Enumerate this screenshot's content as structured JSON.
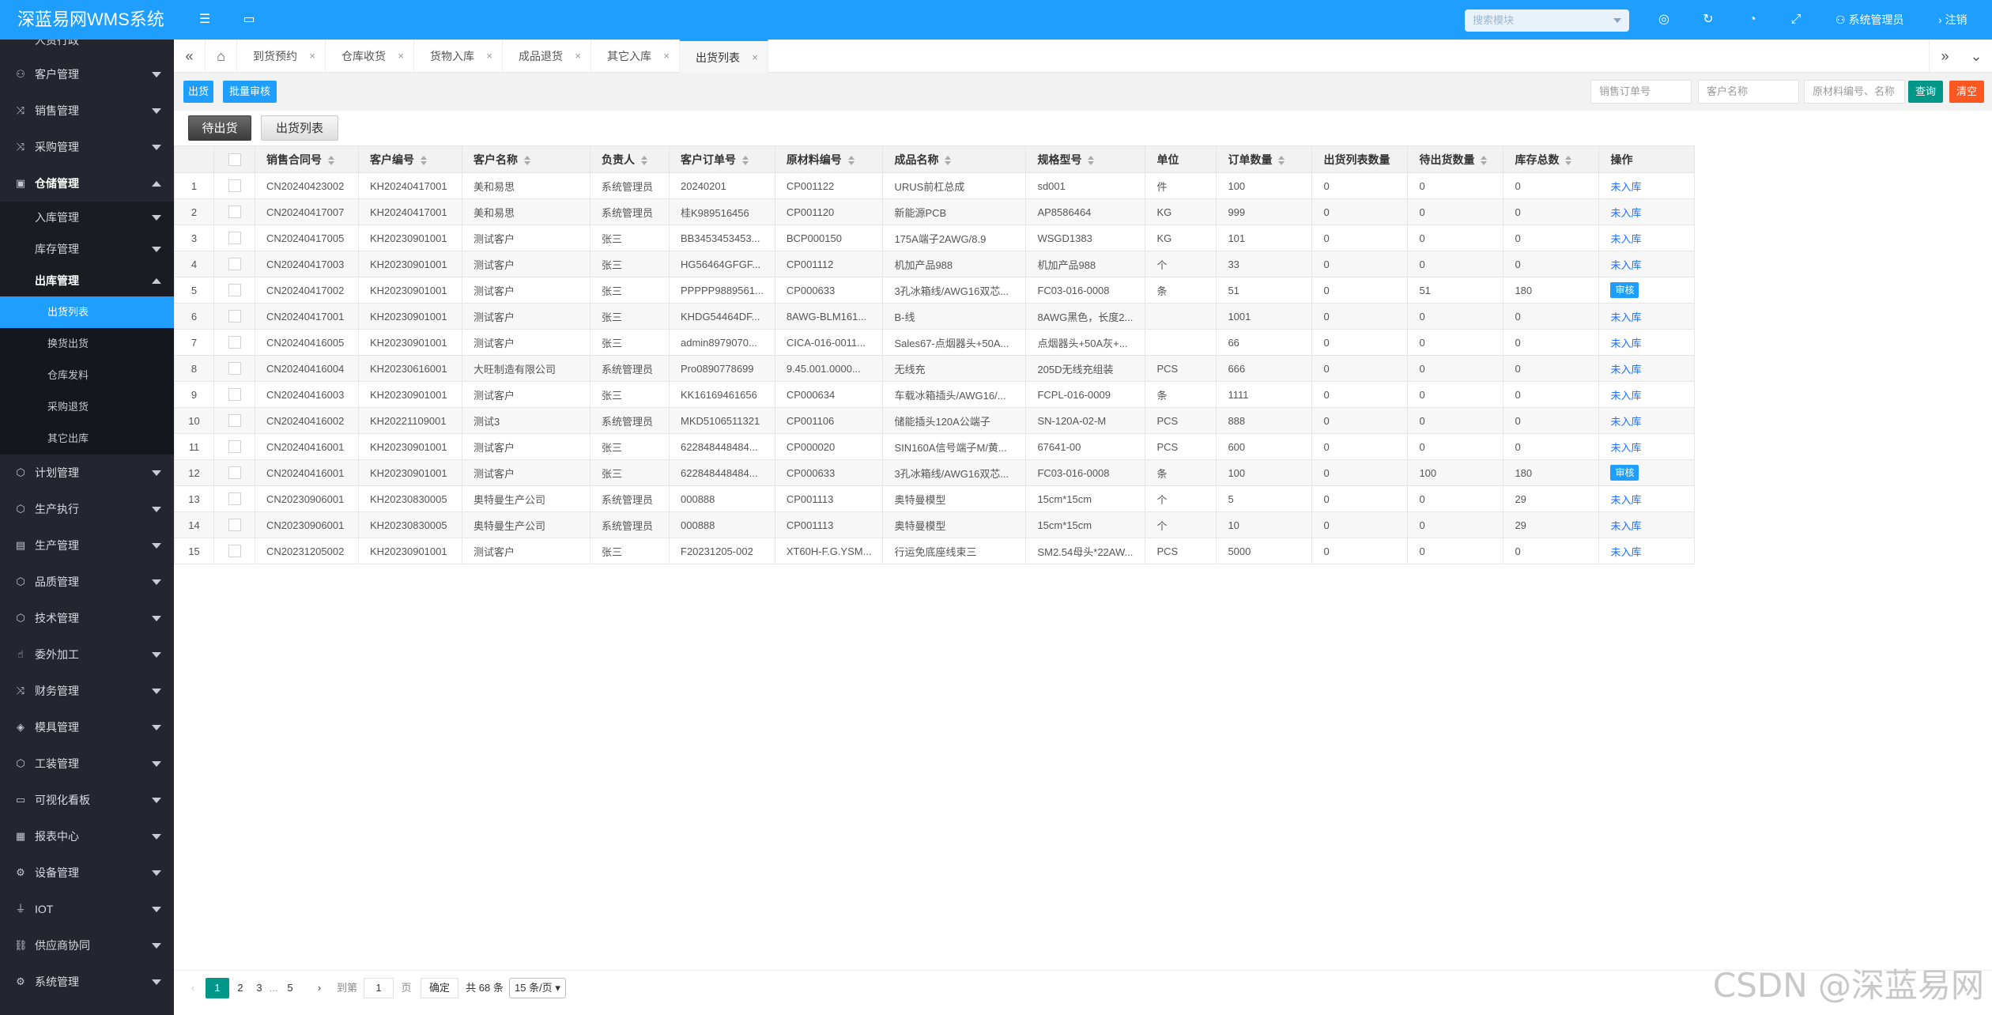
{
  "header": {
    "brand": "深蓝易网WMS系统",
    "search_placeholder": "搜索模块",
    "user": "系统管理员",
    "logout": "注销"
  },
  "sidebar": {
    "partial_top": "人资行政",
    "items": [
      {
        "label": "客户管理",
        "icon": "user-icon"
      },
      {
        "label": "销售管理",
        "icon": "shuffle-icon"
      },
      {
        "label": "采购管理",
        "icon": "shuffle-icon"
      },
      {
        "label": "仓储管理",
        "icon": "box-icon"
      },
      {
        "label": "计划管理",
        "icon": "cube-icon"
      },
      {
        "label": "生产执行",
        "icon": "cube-icon"
      },
      {
        "label": "生产管理",
        "icon": "chart-icon"
      },
      {
        "label": "品质管理",
        "icon": "cube-icon"
      },
      {
        "label": "技术管理",
        "icon": "cube-icon"
      },
      {
        "label": "委外加工",
        "icon": "hand-icon"
      },
      {
        "label": "财务管理",
        "icon": "shuffle-icon"
      },
      {
        "label": "模具管理",
        "icon": "layers-icon"
      },
      {
        "label": "工装管理",
        "icon": "cube-icon"
      },
      {
        "label": "可视化看板",
        "icon": "chat-icon"
      },
      {
        "label": "报表中心",
        "icon": "table-icon"
      },
      {
        "label": "设备管理",
        "icon": "gear-icon"
      },
      {
        "label": "IOT",
        "icon": "iot-icon"
      },
      {
        "label": "供应商协同",
        "icon": "link-icon"
      },
      {
        "label": "系统管理",
        "icon": "gear-icon"
      }
    ],
    "sub_items": [
      {
        "label": "入库管理"
      },
      {
        "label": "库存管理"
      },
      {
        "label": "出库管理"
      }
    ],
    "leaf_items": [
      {
        "label": "出货列表"
      },
      {
        "label": "换货出货"
      },
      {
        "label": "仓库发料"
      },
      {
        "label": "采购退货"
      },
      {
        "label": "其它出库"
      }
    ]
  },
  "tabs": [
    {
      "label": "到货预约"
    },
    {
      "label": "仓库收货"
    },
    {
      "label": "货物入库"
    },
    {
      "label": "成品退货"
    },
    {
      "label": "其它入库"
    },
    {
      "label": "出货列表"
    }
  ],
  "toolbar": {
    "ship_btn": "出货",
    "batch_audit_btn": "批量审核",
    "order_no_placeholder": "销售订单号",
    "customer_placeholder": "客户名称",
    "material_placeholder": "原材料编号、名称",
    "query_btn": "查询",
    "clear_btn": "清空"
  },
  "subtabs": {
    "pending": "待出货",
    "list": "出货列表"
  },
  "table": {
    "columns": [
      "销售合同号",
      "客户编号",
      "客户名称",
      "负责人",
      "客户订单号",
      "原材料编号",
      "成品名称",
      "规格型号",
      "单位",
      "订单数量",
      "出货列表数量",
      "待出货数量",
      "库存总数",
      "操作"
    ],
    "rows": [
      {
        "no": "1",
        "contract": "CN20240423002",
        "cust_id": "KH20240417001",
        "cust_name": "美和易思",
        "owner": "系统管理员",
        "order_no": "20240201",
        "material": "CP001122",
        "product": "URUS前杠总成",
        "spec": "sd001",
        "unit": "件",
        "qty": "100",
        "shipped": "0",
        "pending": "0",
        "stock": "0",
        "op": "未入库",
        "op_type": "link"
      },
      {
        "no": "2",
        "contract": "CN20240417007",
        "cust_id": "KH20240417001",
        "cust_name": "美和易思",
        "owner": "系统管理员",
        "order_no": "桂K989516456",
        "material": "CP001120",
        "product": "新能源PCB",
        "spec": "AP8586464",
        "unit": "KG",
        "qty": "999",
        "shipped": "0",
        "pending": "0",
        "stock": "0",
        "op": "未入库",
        "op_type": "link"
      },
      {
        "no": "3",
        "contract": "CN20240417005",
        "cust_id": "KH20230901001",
        "cust_name": "测试客户",
        "owner": "张三",
        "order_no": "BB3453453453...",
        "material": "BCP000150",
        "product": "175A端子2AWG/8.9",
        "spec": "WSGD1383",
        "unit": "KG",
        "qty": "101",
        "shipped": "0",
        "pending": "0",
        "stock": "0",
        "op": "未入库",
        "op_type": "link"
      },
      {
        "no": "4",
        "contract": "CN20240417003",
        "cust_id": "KH20230901001",
        "cust_name": "测试客户",
        "owner": "张三",
        "order_no": "HG56464GFGF...",
        "material": "CP001112",
        "product": "机加产品988",
        "spec": "机加产品988",
        "unit": "个",
        "qty": "33",
        "shipped": "0",
        "pending": "0",
        "stock": "0",
        "op": "未入库",
        "op_type": "link"
      },
      {
        "no": "5",
        "contract": "CN20240417002",
        "cust_id": "KH20230901001",
        "cust_name": "测试客户",
        "owner": "张三",
        "order_no": "PPPPP9889561...",
        "material": "CP000633",
        "product": "3孔冰箱线/AWG16双芯...",
        "spec": "FC03-016-0008",
        "unit": "条",
        "qty": "51",
        "shipped": "0",
        "pending": "51",
        "stock": "180",
        "op": "审核",
        "op_type": "button"
      },
      {
        "no": "6",
        "contract": "CN20240417001",
        "cust_id": "KH20230901001",
        "cust_name": "测试客户",
        "owner": "张三",
        "order_no": "KHDG54464DF...",
        "material": "8AWG-BLM161...",
        "product": "B-线",
        "spec": "8AWG黑色，长度2...",
        "unit": "",
        "qty": "1001",
        "shipped": "0",
        "pending": "0",
        "stock": "0",
        "op": "未入库",
        "op_type": "link"
      },
      {
        "no": "7",
        "contract": "CN20240416005",
        "cust_id": "KH20230901001",
        "cust_name": "测试客户",
        "owner": "张三",
        "order_no": "admin8979070...",
        "material": "CICA-016-0011...",
        "product": "Sales67-点烟器头+50A...",
        "spec": "点烟器头+50A灰+...",
        "unit": "",
        "qty": "66",
        "shipped": "0",
        "pending": "0",
        "stock": "0",
        "op": "未入库",
        "op_type": "link"
      },
      {
        "no": "8",
        "contract": "CN20240416004",
        "cust_id": "KH20230616001",
        "cust_name": "大旺制造有限公司",
        "owner": "系统管理员",
        "order_no": "Pro0890778699",
        "material": "9.45.001.0000...",
        "product": "无线充",
        "spec": "205D无线充组装",
        "unit": "PCS",
        "qty": "666",
        "shipped": "0",
        "pending": "0",
        "stock": "0",
        "op": "未入库",
        "op_type": "link"
      },
      {
        "no": "9",
        "contract": "CN20240416003",
        "cust_id": "KH20230901001",
        "cust_name": "测试客户",
        "owner": "张三",
        "order_no": "KK16169461656",
        "material": "CP000634",
        "product": "车载冰箱插头/AWG16/...",
        "spec": "FCPL-016-0009",
        "unit": "条",
        "qty": "1111",
        "shipped": "0",
        "pending": "0",
        "stock": "0",
        "op": "未入库",
        "op_type": "link"
      },
      {
        "no": "10",
        "contract": "CN20240416002",
        "cust_id": "KH20221109001",
        "cust_name": "测试3",
        "owner": "系统管理员",
        "order_no": "MKD5106511321",
        "material": "CP001106",
        "product": "储能插头120A公端子",
        "spec": "SN-120A-02-M",
        "unit": "PCS",
        "qty": "888",
        "shipped": "0",
        "pending": "0",
        "stock": "0",
        "op": "未入库",
        "op_type": "link"
      },
      {
        "no": "11",
        "contract": "CN20240416001",
        "cust_id": "KH20230901001",
        "cust_name": "测试客户",
        "owner": "张三",
        "order_no": "622848448484...",
        "material": "CP000020",
        "product": "SIN160A信号端子M/黄...",
        "spec": "67641-00",
        "unit": "PCS",
        "qty": "600",
        "shipped": "0",
        "pending": "0",
        "stock": "0",
        "op": "未入库",
        "op_type": "link"
      },
      {
        "no": "12",
        "contract": "CN20240416001",
        "cust_id": "KH20230901001",
        "cust_name": "测试客户",
        "owner": "张三",
        "order_no": "622848448484...",
        "material": "CP000633",
        "product": "3孔冰箱线/AWG16双芯...",
        "spec": "FC03-016-0008",
        "unit": "条",
        "qty": "100",
        "shipped": "0",
        "pending": "100",
        "stock": "180",
        "op": "审核",
        "op_type": "button"
      },
      {
        "no": "13",
        "contract": "CN20230906001",
        "cust_id": "KH20230830005",
        "cust_name": "奥特曼生产公司",
        "owner": "系统管理员",
        "order_no": "000888",
        "material": "CP001113",
        "product": "奥特曼模型",
        "spec": "15cm*15cm",
        "unit": "个",
        "qty": "5",
        "shipped": "0",
        "pending": "0",
        "stock": "29",
        "op": "未入库",
        "op_type": "link"
      },
      {
        "no": "14",
        "contract": "CN20230906001",
        "cust_id": "KH20230830005",
        "cust_name": "奥特曼生产公司",
        "owner": "系统管理员",
        "order_no": "000888",
        "material": "CP001113",
        "product": "奥特曼模型",
        "spec": "15cm*15cm",
        "unit": "个",
        "qty": "10",
        "shipped": "0",
        "pending": "0",
        "stock": "29",
        "op": "未入库",
        "op_type": "link"
      },
      {
        "no": "15",
        "contract": "CN20231205002",
        "cust_id": "KH20230901001",
        "cust_name": "测试客户",
        "owner": "张三",
        "order_no": "F20231205-002",
        "material": "XT60H-F.G.YSM...",
        "product": "行运免底座线束三",
        "spec": "SM2.54母头*22AW...",
        "unit": "PCS",
        "qty": "5000",
        "shipped": "0",
        "pending": "0",
        "stock": "0",
        "op": "未入库",
        "op_type": "link"
      }
    ]
  },
  "pager": {
    "pages": [
      "1",
      "2",
      "3",
      "...",
      "5"
    ],
    "goto_label": "到第",
    "goto_value": "1",
    "page_unit": "页",
    "confirm": "确定",
    "total": "共 68 条",
    "page_size": "15 条/页"
  },
  "watermark": "CSDN @深蓝易网"
}
